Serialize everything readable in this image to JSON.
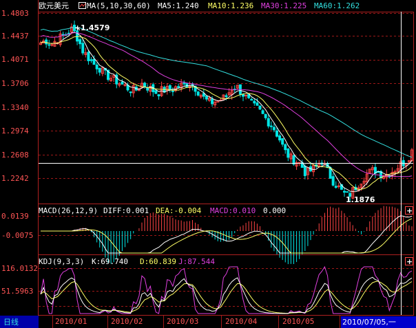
{
  "colors": {
    "up": "#ff4444",
    "down": "#00e5e5",
    "grid": "#a01818",
    "frame": "#b02020",
    "axis_text": "#ff5555",
    "ma5": "#ffffff",
    "ma10": "#ffff66",
    "ma30": "#e040e0",
    "ma60": "#33e0e0",
    "macd_line": "#ffffff",
    "signal_line": "#ffff66",
    "k_line": "#ffffff",
    "d_line": "#ffff66",
    "j_line": "#e040e0",
    "date_bg": "#0000cc"
  },
  "main_panel": {
    "title": "欧元美元",
    "indicator": "MA(5,10,30,60)",
    "ma5_label": "MA5:1.240",
    "ma10_label": "MA10:1.236",
    "ma30_label": "MA30:1.225",
    "ma60_label": "MA60:1.262",
    "y_ticks": [
      "1.4803",
      "1.4437",
      "1.4071",
      "1.3706",
      "1.3340",
      "1.2974",
      "1.2608",
      "1.2242"
    ],
    "high_label": "1.4579",
    "low_label": "1.1876"
  },
  "macd_panel": {
    "indicator": "MACD(26,12,9)",
    "diff_label": "DIFF:0.001",
    "dea_label": "DEA:-0.004",
    "macd_label": "MACD:0.010",
    "extra_label": "0.000",
    "y_ticks": [
      "0.0139",
      "-0.0075"
    ]
  },
  "kdj_panel": {
    "indicator": "KDJ(9,3,3)",
    "k_label": "K:69.740",
    "d_label": "D:60.839",
    "j_label": "J:87.544",
    "y_ticks": [
      "116.0132",
      "51.5963"
    ]
  },
  "footer": {
    "period_tab": "日线",
    "x_labels": [
      "2010/01",
      "2010/02",
      "2010/03",
      "2010/04",
      "2010/05"
    ],
    "date_box": "2010/07/05,一"
  },
  "buttons": {
    "expand": "+"
  },
  "chart_data": {
    "type": "candlestick",
    "instrument": "欧元美元",
    "months": [
      "2010/01",
      "2010/02",
      "2010/03",
      "2010/04",
      "2010/05"
    ],
    "ylim": [
      1.1876,
      1.4803
    ],
    "high": 1.4579,
    "low": 1.1876,
    "close_path": [
      1.433,
      1.437,
      1.43,
      1.438,
      1.443,
      1.448,
      1.455,
      1.44,
      1.42,
      1.41,
      1.4,
      1.395,
      1.385,
      1.38,
      1.375,
      1.37,
      1.365,
      1.36,
      1.36,
      1.37,
      1.365,
      1.36,
      1.355,
      1.36,
      1.36,
      1.362,
      1.365,
      1.368,
      1.37,
      1.365,
      1.355,
      1.345,
      1.34,
      1.342,
      1.345,
      1.35,
      1.362,
      1.365,
      1.355,
      1.345,
      1.335,
      1.33,
      1.32,
      1.31,
      1.3,
      1.285,
      1.265,
      1.255,
      1.25,
      1.245,
      1.23,
      1.235,
      1.24,
      1.25,
      1.235,
      1.22,
      1.21,
      1.2,
      1.195,
      1.205,
      1.215,
      1.225,
      1.232,
      1.236,
      1.23,
      1.228,
      1.232,
      1.238,
      1.245,
      1.25,
      1.265
    ],
    "moving_averages": [
      {
        "name": "MA5",
        "value": 1.24
      },
      {
        "name": "MA10",
        "value": 1.236
      },
      {
        "name": "MA30",
        "value": 1.225
      },
      {
        "name": "MA60",
        "value": 1.262
      }
    ],
    "macd": {
      "DIFF": 0.001,
      "DEA": -0.004,
      "MACD": 0.01,
      "ylim": [
        -0.0075,
        0.0139
      ]
    },
    "kdj": {
      "K": 69.74,
      "D": 60.839,
      "J": 87.544,
      "ylim": [
        51.5963,
        116.0132
      ]
    }
  }
}
